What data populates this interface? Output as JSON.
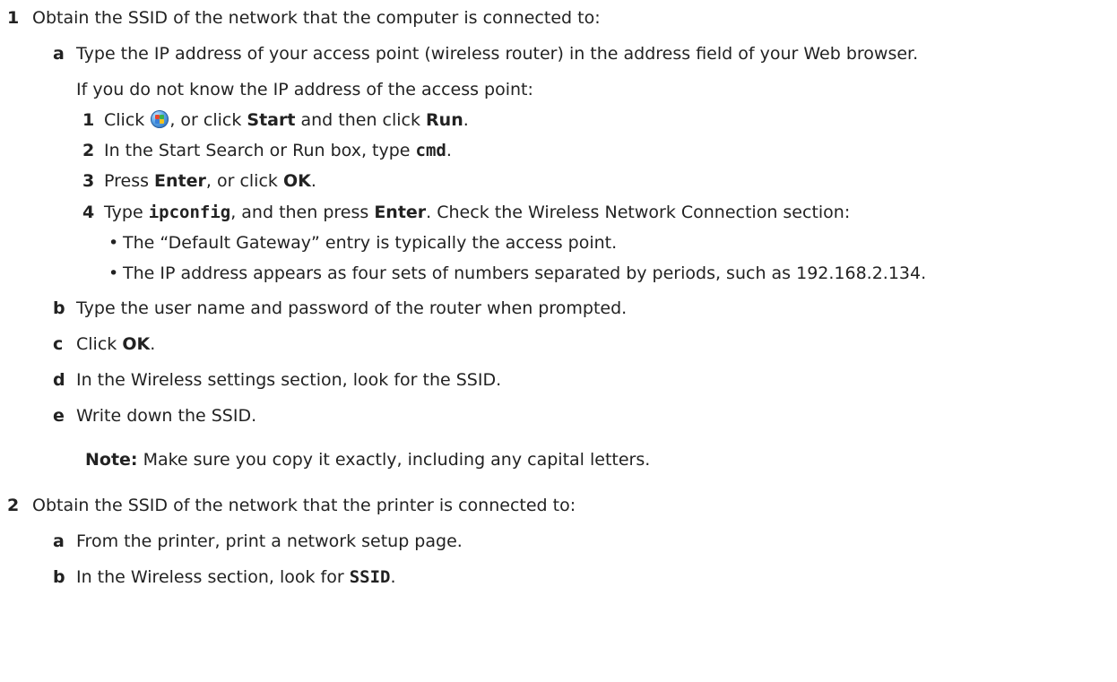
{
  "step1": {
    "num": "1",
    "text": "Obtain the SSID of the network that the computer is connected to:",
    "a": {
      "letter": "a",
      "text": "Type the IP address of your access point (wireless router) in the address field of your Web browser.",
      "if_unknown": "If you do not know the IP address of the access point:",
      "sub": {
        "s1": {
          "num": "1",
          "pre": "Click ",
          "mid": ", or click ",
          "start": "Start",
          "and_then": " and then click ",
          "run": "Run",
          "end": "."
        },
        "s2": {
          "num": "2",
          "pre": "In the Start Search or Run box, type ",
          "cmd": "cmd",
          "end": "."
        },
        "s3": {
          "num": "3",
          "pre": "Press ",
          "enter": "Enter",
          "mid": ", or click ",
          "ok": "OK",
          "end": "."
        },
        "s4": {
          "num": "4",
          "pre": "Type ",
          "ipconfig": "ipconfig",
          "mid": ", and then press ",
          "enter": "Enter",
          "end": ". Check the Wireless Network Connection section:"
        },
        "bullets": [
          "The “Default Gateway” entry is typically the access point.",
          "The IP address appears as four sets of numbers separated by periods, such as 192.168.2.134."
        ]
      }
    },
    "b": {
      "letter": "b",
      "text": "Type the user name and password of the router when prompted."
    },
    "c": {
      "letter": "c",
      "pre": "Click ",
      "ok": "OK",
      "end": "."
    },
    "d": {
      "letter": "d",
      "text": "In the Wireless settings section, look for the SSID."
    },
    "e": {
      "letter": "e",
      "text": "Write down the SSID."
    },
    "note": {
      "label": "Note:",
      "text": " Make sure you copy it exactly, including any capital letters."
    }
  },
  "step2": {
    "num": "2",
    "text": "Obtain the SSID of the network that the printer is connected to:",
    "a": {
      "letter": "a",
      "text": "From the printer, print a network setup page."
    },
    "b": {
      "letter": "b",
      "pre": "In the Wireless section, look for ",
      "ssid": "SSID",
      "end": "."
    }
  },
  "icons": {
    "windows_start": "windows-start-orb-icon"
  }
}
